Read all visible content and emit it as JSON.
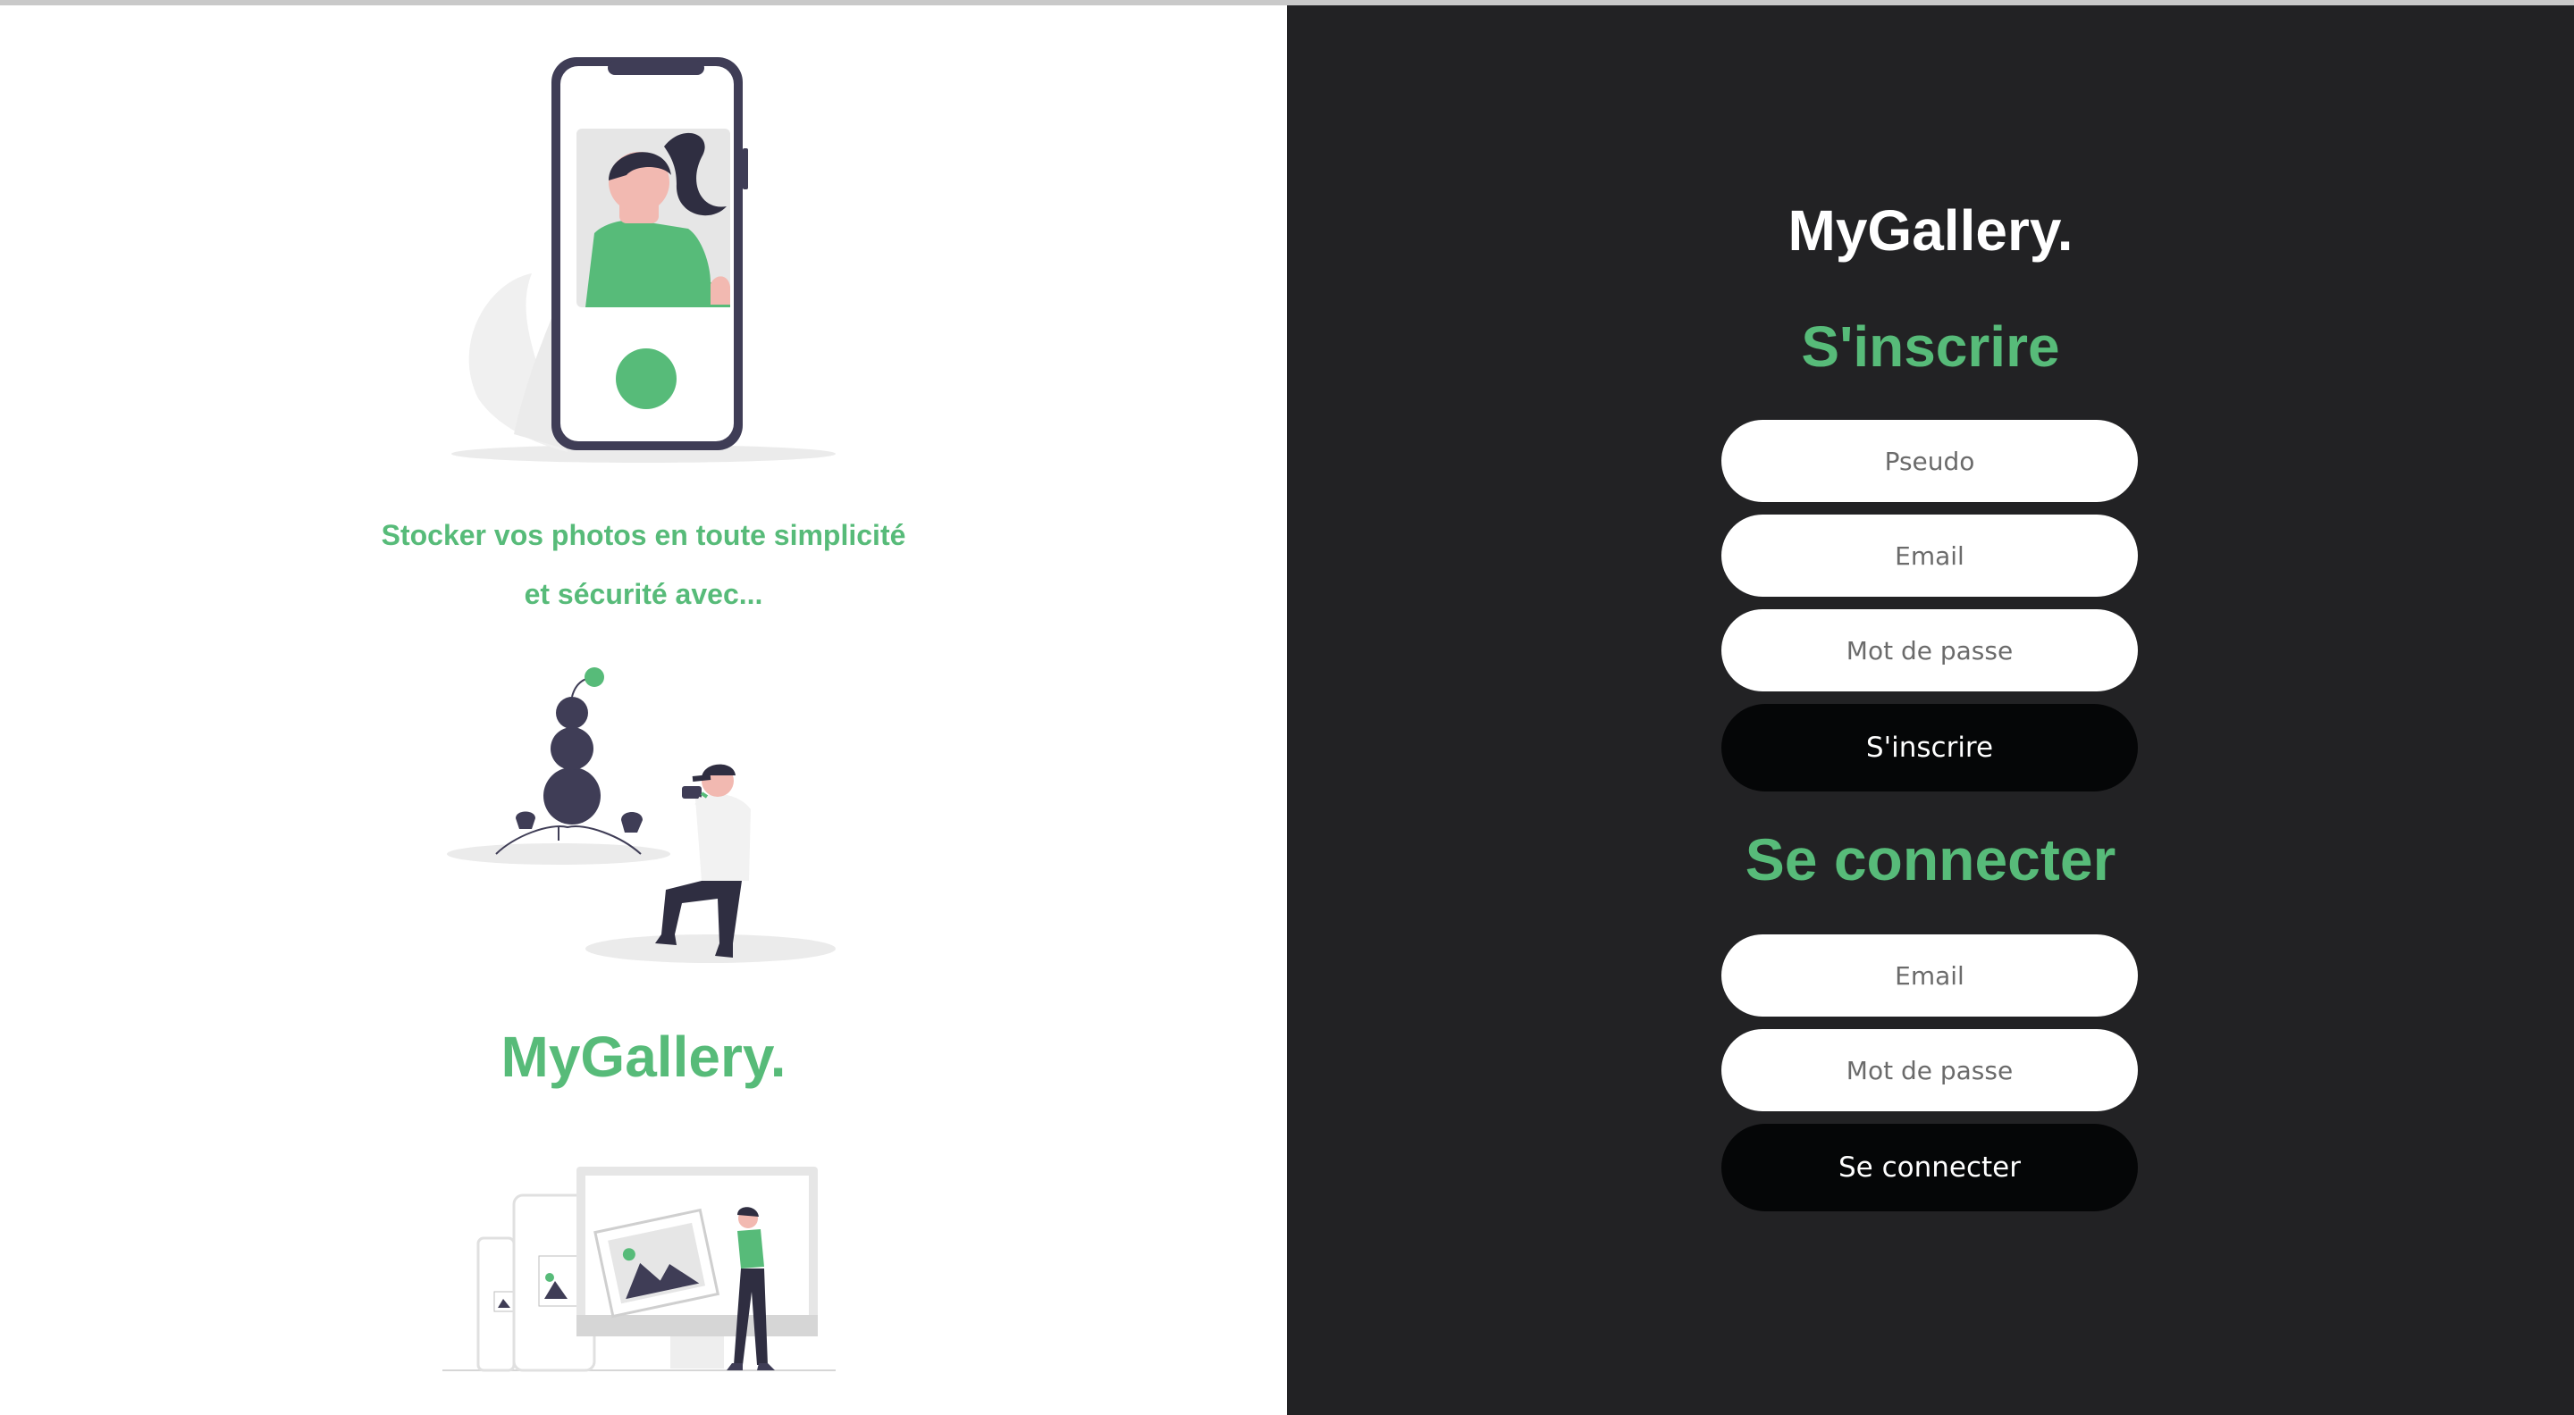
{
  "left": {
    "tagline_line1": "Stocker vos photos en toute simplicité",
    "tagline_line2": "et sécurité avec...",
    "brand": "MyGallery."
  },
  "right": {
    "brand": "MyGallery.",
    "signup": {
      "title": "S'inscrire",
      "pseudo_placeholder": "Pseudo",
      "email_placeholder": "Email",
      "password_placeholder": "Mot de passe",
      "button": "S'inscrire"
    },
    "login": {
      "title": "Se connecter",
      "email_placeholder": "Email",
      "password_placeholder": "Mot de passe",
      "button": "Se connecter"
    }
  },
  "colors": {
    "accent": "#57bb79",
    "dark_panel": "#222224",
    "button": "#050607",
    "figure_dark": "#3f3d56"
  },
  "icons": [
    "phone-selfie-illustration",
    "photographer-illustration",
    "devices-gallery-illustration"
  ]
}
